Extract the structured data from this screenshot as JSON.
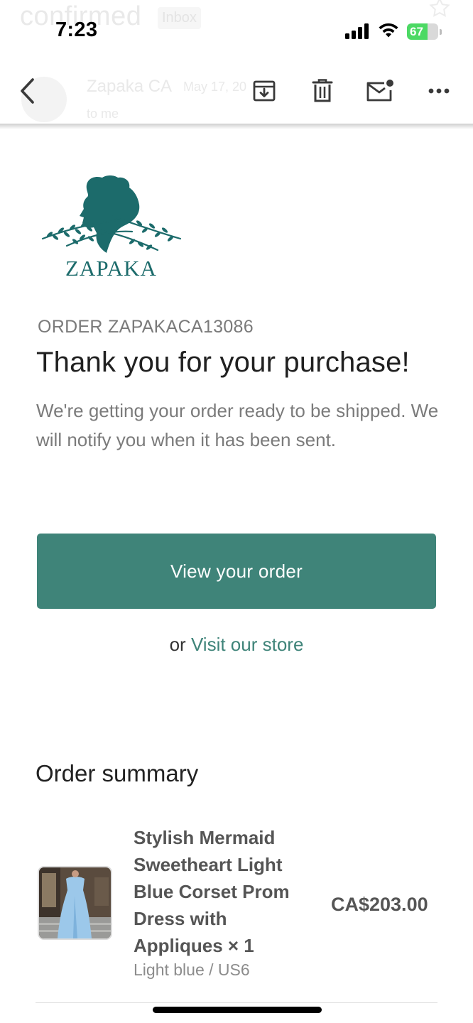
{
  "status_bar": {
    "time": "7:23",
    "battery": "67",
    "battery_level": 0.67,
    "battery_color": "#4cd964"
  },
  "background_header": {
    "subject": "confirmed",
    "label": "Inbox",
    "sender": "Zapaka CA",
    "date": "May 17, 20",
    "recipient": "to me"
  },
  "toolbar": {
    "back_icon": "chevron-left-icon",
    "archive_icon": "archive-icon",
    "delete_icon": "trash-icon",
    "mark_unread_icon": "mail-unread-icon",
    "more_icon": "more-horizontal-icon"
  },
  "brand": {
    "logo_text": "ZAPAKA",
    "accent_color": "#3f8479"
  },
  "order": {
    "number": "ORDER ZAPAKACA13086",
    "headline": "Thank you for your purchase!",
    "message": "We're getting your order ready to be shipped. We will notify you when it has been sent.",
    "view_order_label": "View your order",
    "or_text": "or",
    "store_link_label": "Visit our store"
  },
  "summary": {
    "title": "Order summary",
    "items": [
      {
        "name": "Stylish Mermaid Sweetheart Light Blue Corset Prom Dress with Appliques × 1",
        "variant": "Light blue / US6",
        "price": "CA$203.00"
      }
    ]
  }
}
